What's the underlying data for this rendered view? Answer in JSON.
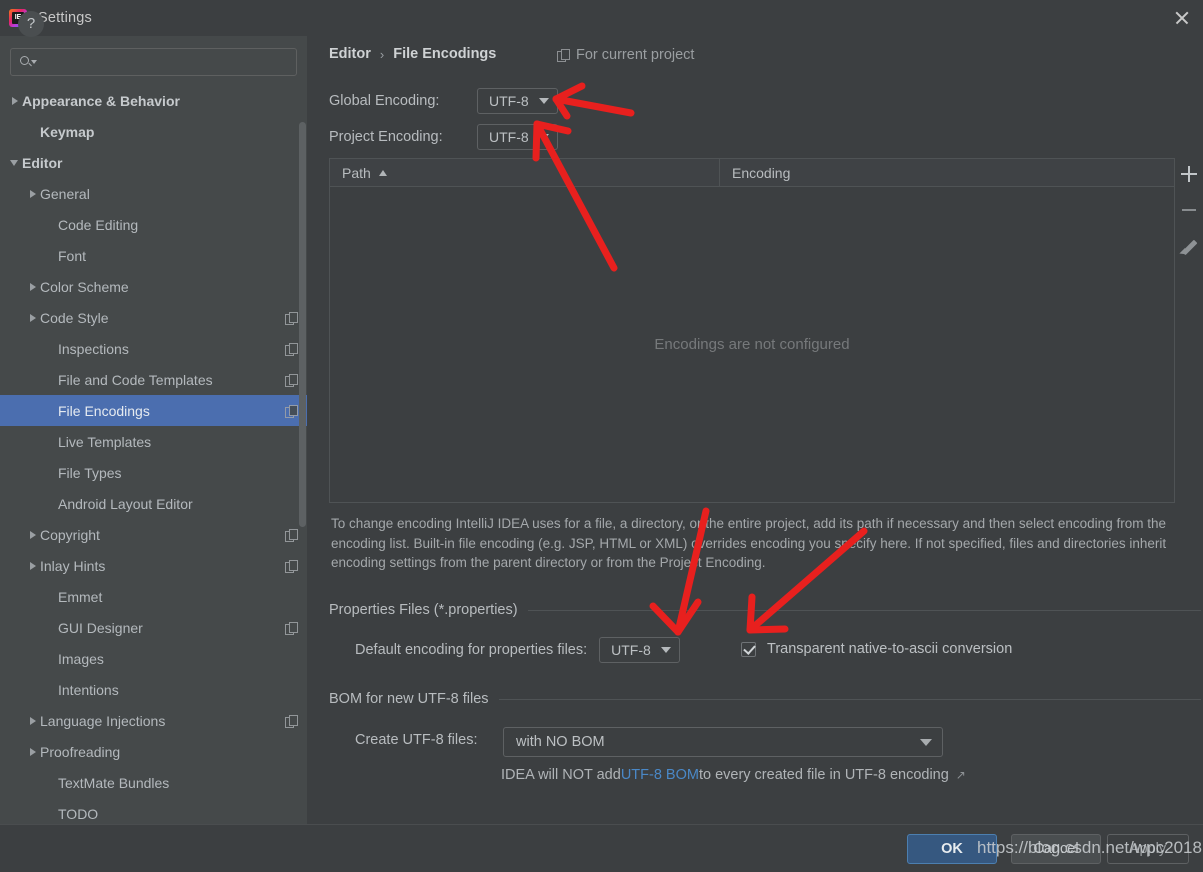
{
  "window": {
    "title": "Settings",
    "logo_text": "IE",
    "close_icon": "close-icon"
  },
  "sidebar": {
    "search": {
      "value": "",
      "placeholder": ""
    },
    "items": [
      {
        "label": "Appearance & Behavior",
        "indent": 0,
        "arrow": "closed",
        "bold": true,
        "copy": false,
        "selected": false
      },
      {
        "label": "Keymap",
        "indent": 1,
        "arrow": "none",
        "bold": true,
        "copy": false,
        "selected": false
      },
      {
        "label": "Editor",
        "indent": 0,
        "arrow": "open",
        "bold": true,
        "copy": false,
        "selected": false
      },
      {
        "label": "General",
        "indent": 1,
        "arrow": "closed",
        "bold": false,
        "copy": false,
        "selected": false
      },
      {
        "label": "Code Editing",
        "indent": 2,
        "arrow": "none",
        "bold": false,
        "copy": false,
        "selected": false
      },
      {
        "label": "Font",
        "indent": 2,
        "arrow": "none",
        "bold": false,
        "copy": false,
        "selected": false
      },
      {
        "label": "Color Scheme",
        "indent": 1,
        "arrow": "closed",
        "bold": false,
        "copy": false,
        "selected": false
      },
      {
        "label": "Code Style",
        "indent": 1,
        "arrow": "closed",
        "bold": false,
        "copy": true,
        "selected": false
      },
      {
        "label": "Inspections",
        "indent": 2,
        "arrow": "none",
        "bold": false,
        "copy": true,
        "selected": false
      },
      {
        "label": "File and Code Templates",
        "indent": 2,
        "arrow": "none",
        "bold": false,
        "copy": true,
        "selected": false
      },
      {
        "label": "File Encodings",
        "indent": 2,
        "arrow": "none",
        "bold": false,
        "copy": true,
        "selected": true
      },
      {
        "label": "Live Templates",
        "indent": 2,
        "arrow": "none",
        "bold": false,
        "copy": false,
        "selected": false
      },
      {
        "label": "File Types",
        "indent": 2,
        "arrow": "none",
        "bold": false,
        "copy": false,
        "selected": false
      },
      {
        "label": "Android Layout Editor",
        "indent": 2,
        "arrow": "none",
        "bold": false,
        "copy": false,
        "selected": false
      },
      {
        "label": "Copyright",
        "indent": 1,
        "arrow": "closed",
        "bold": false,
        "copy": true,
        "selected": false
      },
      {
        "label": "Inlay Hints",
        "indent": 1,
        "arrow": "closed",
        "bold": false,
        "copy": true,
        "selected": false
      },
      {
        "label": "Emmet",
        "indent": 2,
        "arrow": "none",
        "bold": false,
        "copy": false,
        "selected": false
      },
      {
        "label": "GUI Designer",
        "indent": 2,
        "arrow": "none",
        "bold": false,
        "copy": true,
        "selected": false
      },
      {
        "label": "Images",
        "indent": 2,
        "arrow": "none",
        "bold": false,
        "copy": false,
        "selected": false
      },
      {
        "label": "Intentions",
        "indent": 2,
        "arrow": "none",
        "bold": false,
        "copy": false,
        "selected": false
      },
      {
        "label": "Language Injections",
        "indent": 1,
        "arrow": "closed",
        "bold": false,
        "copy": true,
        "selected": false
      },
      {
        "label": "Proofreading",
        "indent": 1,
        "arrow": "closed",
        "bold": false,
        "copy": false,
        "selected": false
      },
      {
        "label": "TextMate Bundles",
        "indent": 2,
        "arrow": "none",
        "bold": false,
        "copy": false,
        "selected": false
      },
      {
        "label": "TODO",
        "indent": 2,
        "arrow": "none",
        "bold": false,
        "copy": false,
        "selected": false
      }
    ]
  },
  "main": {
    "breadcrumb": {
      "parent": "Editor",
      "separator": "›",
      "current": "File Encodings"
    },
    "for_current_project": "For current project",
    "global_encoding": {
      "label": "Global Encoding:",
      "value": "UTF-8"
    },
    "project_encoding": {
      "label": "Project Encoding:",
      "value": "UTF-8"
    },
    "table": {
      "columns": [
        "Path",
        "Encoding"
      ],
      "sort_column": "Path",
      "sort_direction": "asc",
      "rows": [],
      "empty_text": "Encodings are not configured",
      "tools": [
        "add-row-button",
        "remove-row-button",
        "edit-row-button"
      ]
    },
    "description": "To change encoding IntelliJ IDEA uses for a file, a directory, or the entire project, add its path if necessary and then select encoding from the encoding list. Built-in file encoding (e.g. JSP, HTML or XML) overrides encoding you specify here. If not specified, files and directories inherit encoding settings from the parent directory or from the Project Encoding.",
    "properties_section": {
      "title": "Properties Files (*.properties)",
      "default_encoding_label": "Default encoding for properties files:",
      "default_encoding_value": "UTF-8",
      "transparent_label": "Transparent native-to-ascii conversion",
      "transparent_checked": true
    },
    "bom_section": {
      "title": "BOM for new UTF-8 files",
      "create_label": "Create UTF-8 files:",
      "create_value": "with NO BOM",
      "note_prefix": "IDEA will NOT add ",
      "note_link": "UTF-8 BOM",
      "note_suffix": " to every created file in UTF-8 encoding",
      "external_arrow": "↗"
    }
  },
  "footer": {
    "help_label": "?",
    "ok_label": "OK",
    "cancel_label": "Cancel",
    "apply_label": "Apply",
    "watermark": "https://blog.csdn.net/wpc2018"
  },
  "colors": {
    "window_bg": "#3c3f41",
    "sidebar_bg": "#45494a",
    "selection_blue": "#4b6eaf",
    "ok_button_blue": "#365880",
    "link_blue": "#4a88c7",
    "annotation_red": "#e8201e",
    "text_primary": "#bbbbbb"
  }
}
